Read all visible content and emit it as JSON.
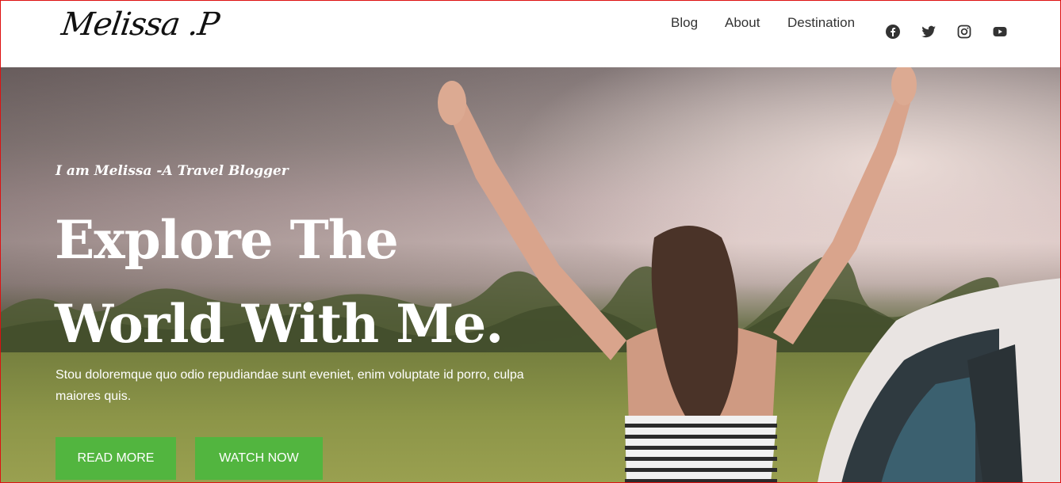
{
  "header": {
    "logo": "Melissa .P",
    "nav": [
      "Blog",
      "About",
      "Destination"
    ],
    "social": [
      "facebook-icon",
      "twitter-icon",
      "instagram-icon",
      "youtube-icon"
    ]
  },
  "hero": {
    "tagline": "I am Melissa -A Travel Blogger",
    "headline_line1": "Explore The",
    "headline_line2": "World With Me.",
    "description": "Stou doloremque quo odio repudiandae sunt eveniet, enim voluptate id porro, culpa maiores quis.",
    "buttons": {
      "read_more": "READ MORE",
      "watch_now": "WATCH NOW"
    }
  },
  "colors": {
    "accent": "#52b53f",
    "header_bg": "#ffffff",
    "nav_text": "#333333"
  }
}
